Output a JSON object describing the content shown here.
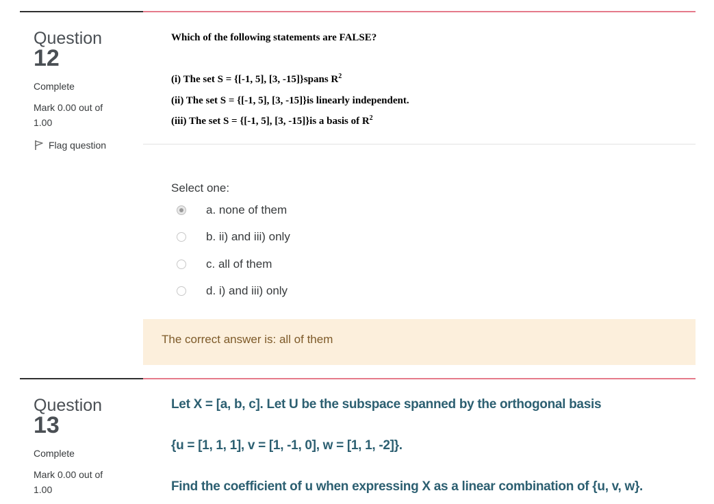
{
  "questions": [
    {
      "label": "Question",
      "number": "12",
      "state": "Complete",
      "grade": "Mark 0.00 out of 1.00",
      "flag_label": "Flag question",
      "prompt": "Which of the following statements are FALSE?",
      "statements": [
        {
          "text": "(i) The set S = {[-1, 5], [3, -15]}spans R",
          "sup": "2"
        },
        {
          "text": "(ii) The set S = {[-1, 5], [3, -15]}is linearly independent.",
          "sup": ""
        },
        {
          "text": "(iii) The set S = {[-1, 5], [3, -15]}is a basis of R",
          "sup": "2"
        }
      ],
      "select_prompt": "Select one:",
      "options": [
        {
          "label": "a. none of them",
          "selected": true
        },
        {
          "label": "b. ii) and iii) only",
          "selected": false
        },
        {
          "label": "c. all of them",
          "selected": false
        },
        {
          "label": "d. i) and iii) only",
          "selected": false
        }
      ],
      "feedback": "The correct answer is: all of them"
    },
    {
      "label": "Question",
      "number": "13",
      "state": "Complete",
      "grade": "Mark 0.00 out of 1.00",
      "lines": [
        "Let X = [a, b, c]. Let U be the subspace spanned by the orthogonal basis",
        "{u = [1, 1, 1], v = [1, -1, 0], w = [1, 1, -2]}.",
        "Find the coefficient of u when expressing X as a linear combination of {u, v, w}."
      ]
    }
  ],
  "colors": {
    "accent_rule": "#e57a8a",
    "feedback_bg": "#fcefdc",
    "feedback_text": "#7d5a29",
    "question_text_teal": "#2c5f71"
  }
}
